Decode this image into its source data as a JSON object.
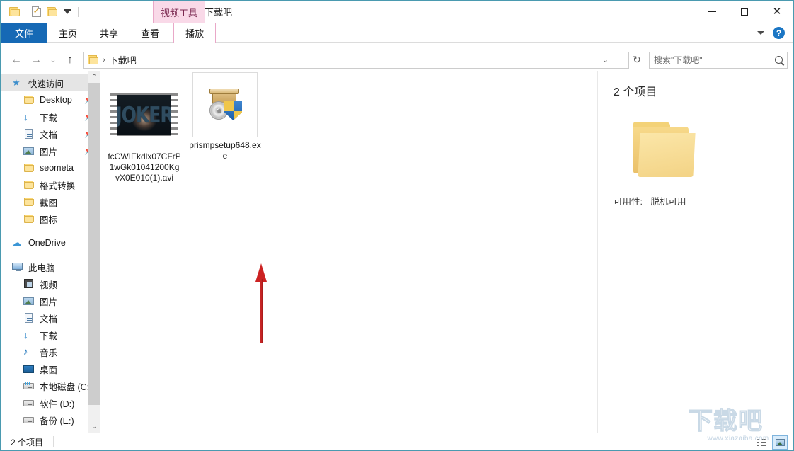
{
  "window": {
    "title": "下载吧",
    "contextual_tab_group": "视频工具",
    "controls": {
      "minimize": "—",
      "maximize": "□",
      "close": "✕"
    }
  },
  "quick_access_toolbar": {
    "items": [
      {
        "name": "folder-icon",
        "label": ""
      },
      {
        "name": "properties-icon",
        "label": ""
      },
      {
        "name": "new-folder-icon",
        "label": ""
      },
      {
        "name": "customize-dropdown",
        "label": ""
      }
    ]
  },
  "ribbon": {
    "tabs": [
      {
        "label": "文件",
        "active": true
      },
      {
        "label": "主页",
        "active": false
      },
      {
        "label": "共享",
        "active": false
      },
      {
        "label": "查看",
        "active": false
      },
      {
        "label": "播放",
        "active": false,
        "contextual": true
      }
    ],
    "collapse_label": "",
    "help_label": "?"
  },
  "addressbar": {
    "back": "←",
    "forward": "→",
    "recent": "⌄",
    "up": "↑",
    "crumb": "下载吧",
    "crumb_separator": "›",
    "dropdown": "⌄",
    "refresh": "↻"
  },
  "search": {
    "placeholder": "搜索\"下载吧\"",
    "icon": "search-icon"
  },
  "sidebar": {
    "items": [
      {
        "label": "快速访问",
        "icon": "star-icon",
        "level": 1,
        "selected": true,
        "pinned": false
      },
      {
        "label": "Desktop",
        "icon": "folder-icon",
        "level": 2,
        "selected": false,
        "pinned": true
      },
      {
        "label": "下载",
        "icon": "download-icon",
        "level": 2,
        "selected": false,
        "pinned": true
      },
      {
        "label": "文档",
        "icon": "document-icon",
        "level": 2,
        "selected": false,
        "pinned": true
      },
      {
        "label": "图片",
        "icon": "pictures-icon",
        "level": 2,
        "selected": false,
        "pinned": true
      },
      {
        "label": "seometa",
        "icon": "folder-icon",
        "level": 2,
        "selected": false,
        "pinned": false
      },
      {
        "label": "格式转换",
        "icon": "folder-icon",
        "level": 2,
        "selected": false,
        "pinned": false
      },
      {
        "label": "截图",
        "icon": "folder-icon",
        "level": 2,
        "selected": false,
        "pinned": false
      },
      {
        "label": "图标",
        "icon": "folder-icon",
        "level": 2,
        "selected": false,
        "pinned": false
      },
      {
        "label": "OneDrive",
        "icon": "cloud-icon",
        "level": 1,
        "selected": false,
        "pinned": false,
        "gap": true
      },
      {
        "label": "此电脑",
        "icon": "computer-icon",
        "level": 1,
        "selected": false,
        "pinned": false,
        "gap": true
      },
      {
        "label": "视频",
        "icon": "video-icon",
        "level": 2,
        "selected": false,
        "pinned": false
      },
      {
        "label": "图片",
        "icon": "pictures-icon",
        "level": 2,
        "selected": false,
        "pinned": false
      },
      {
        "label": "文档",
        "icon": "document-icon",
        "level": 2,
        "selected": false,
        "pinned": false
      },
      {
        "label": "下载",
        "icon": "download-icon",
        "level": 2,
        "selected": false,
        "pinned": false
      },
      {
        "label": "音乐",
        "icon": "music-icon",
        "level": 2,
        "selected": false,
        "pinned": false
      },
      {
        "label": "桌面",
        "icon": "desktop-icon",
        "level": 2,
        "selected": false,
        "pinned": false
      },
      {
        "label": "本地磁盘 (C:)",
        "icon": "system-drive-icon",
        "level": 2,
        "selected": false,
        "pinned": false
      },
      {
        "label": "软件 (D:)",
        "icon": "drive-icon",
        "level": 2,
        "selected": false,
        "pinned": false
      },
      {
        "label": "备份 (E:)",
        "icon": "drive-icon",
        "level": 2,
        "selected": false,
        "pinned": false
      }
    ],
    "scroll_up": "⌃",
    "scroll_down": "⌄"
  },
  "files": [
    {
      "name": "fcCWIEkdlx07CFrP1wGk01041200KgvX0E010(1).avi",
      "type": "video",
      "thumbnail_text": "JOKER"
    },
    {
      "name": "prismpsetup648.exe",
      "type": "executable",
      "thumbnail_text": ""
    }
  ],
  "annotation": {
    "type": "red-arrow",
    "direction": "up"
  },
  "details_pane": {
    "title": "2 个项目",
    "icon": "folder-icon",
    "availability_key": "可用性:",
    "availability_value": "脱机可用"
  },
  "statusbar": {
    "item_count": "2 个项目",
    "view_details_icon": "details-view-icon",
    "view_thumbnail_icon": "thumbnail-view-icon"
  },
  "watermark": {
    "text": "下载吧",
    "url": "www.xiazaiba.com"
  },
  "colors": {
    "accent": "#1669b5",
    "contextual": "#f9d9e8",
    "folder": "#fcd976",
    "arrow": "#cc2222"
  }
}
